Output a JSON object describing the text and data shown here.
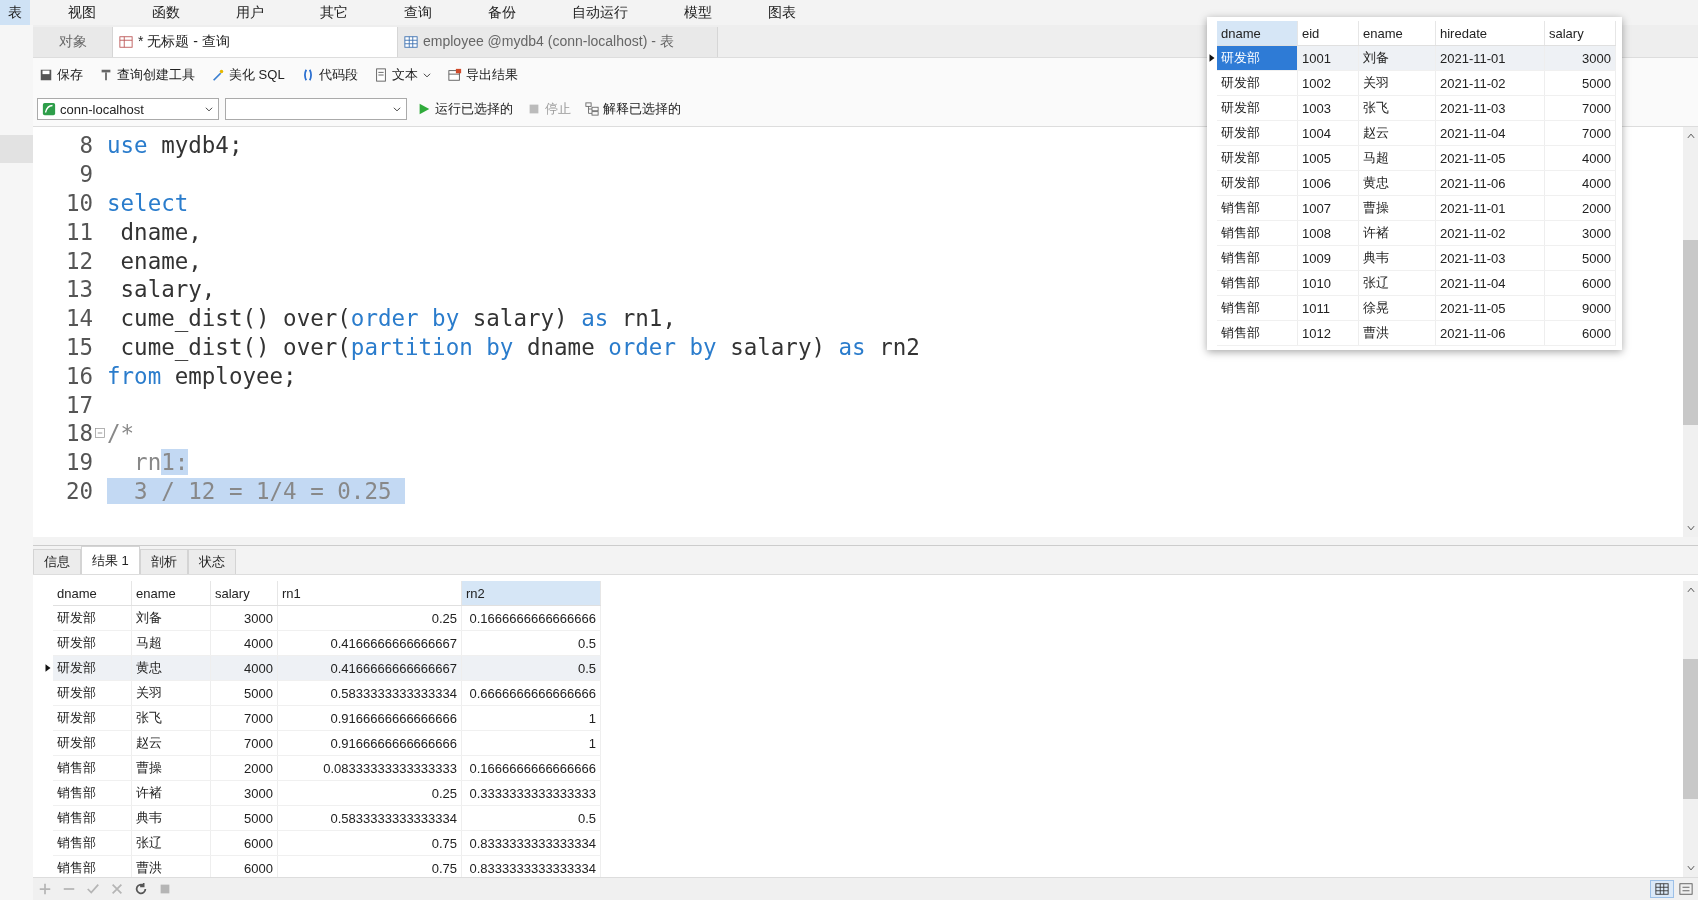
{
  "menu": [
    {
      "label": "表",
      "selected": true
    },
    {
      "label": "视图",
      "selected": false
    },
    {
      "label": "函数",
      "selected": false
    },
    {
      "label": "用户",
      "selected": false
    },
    {
      "label": "其它",
      "selected": false
    },
    {
      "label": "查询",
      "selected": false
    },
    {
      "label": "备份",
      "selected": false
    },
    {
      "label": "自动运行",
      "selected": false
    },
    {
      "label": "模型",
      "selected": false
    },
    {
      "label": "图表",
      "selected": false
    }
  ],
  "tabs": [
    {
      "label": "对象",
      "kind": "plain",
      "selected": false
    },
    {
      "label": "* 无标题 - 查询",
      "kind": "query",
      "selected": true
    },
    {
      "label": "employee @mydb4 (conn-localhost) - 表",
      "kind": "table",
      "selected": false
    }
  ],
  "toolbar": [
    {
      "label": "保存",
      "kind": "save"
    },
    {
      "label": "查询创建工具",
      "kind": "builder"
    },
    {
      "label": "美化 SQL",
      "kind": "beautify"
    },
    {
      "label": "代码段",
      "kind": "snippet"
    },
    {
      "label": "文本",
      "kind": "text"
    },
    {
      "label": "导出结果",
      "kind": "export"
    }
  ],
  "connection": {
    "value": "conn-localhost"
  },
  "run_bar": [
    {
      "label": "运行已选择的",
      "kind": "run",
      "disabled": false
    },
    {
      "label": "停止",
      "kind": "stop",
      "disabled": true
    },
    {
      "label": "解释已选择的",
      "kind": "explain",
      "disabled": false
    }
  ],
  "editor": {
    "lines": [
      {
        "number": "8",
        "fold": false,
        "segments": [
          {
            "text": "use",
            "kind": "keyword",
            "selected": false
          },
          {
            "text": " mydb4;",
            "kind": "plain",
            "selected": false
          }
        ]
      },
      {
        "number": "9",
        "fold": false
      },
      {
        "number": "10",
        "fold": false,
        "segments": [
          {
            "text": "select",
            "kind": "keyword",
            "selected": false
          }
        ]
      },
      {
        "number": "11",
        "fold": false,
        "segments": [
          {
            "text": " dname,",
            "kind": "plain",
            "selected": false
          }
        ]
      },
      {
        "number": "12",
        "fold": false,
        "segments": [
          {
            "text": " ename,",
            "kind": "plain",
            "selected": false
          }
        ]
      },
      {
        "number": "13",
        "fold": false,
        "segments": [
          {
            "text": " salary,",
            "kind": "plain",
            "selected": false
          }
        ]
      },
      {
        "number": "14",
        "fold": false,
        "segments": [
          {
            "text": " cume_dist() over(",
            "kind": "plain",
            "selected": false
          },
          {
            "text": "order by",
            "kind": "keyword",
            "selected": false
          },
          {
            "text": " salary) ",
            "kind": "plain",
            "selected": false
          },
          {
            "text": "as",
            "kind": "keyword",
            "selected": false
          },
          {
            "text": " rn1,",
            "kind": "plain",
            "selected": false
          }
        ]
      },
      {
        "number": "15",
        "fold": false,
        "segments": [
          {
            "text": " cume_dist() over(",
            "kind": "plain",
            "selected": false
          },
          {
            "text": "partition by",
            "kind": "keyword",
            "selected": false
          },
          {
            "text": " dname ",
            "kind": "plain",
            "selected": false
          },
          {
            "text": "order by",
            "kind": "keyword",
            "selected": false
          },
          {
            "text": " salary) ",
            "kind": "plain",
            "selected": false
          },
          {
            "text": "as",
            "kind": "keyword",
            "selected": false
          },
          {
            "text": " rn2",
            "kind": "plain",
            "selected": false
          }
        ]
      },
      {
        "number": "16",
        "fold": false,
        "segments": [
          {
            "text": "from",
            "kind": "keyword",
            "selected": false
          },
          {
            "text": " employee;",
            "kind": "plain",
            "selected": false
          }
        ]
      },
      {
        "number": "17",
        "fold": false
      },
      {
        "number": "18",
        "fold": true,
        "segments": [
          {
            "text": "/*",
            "kind": "comment",
            "selected": false
          }
        ]
      },
      {
        "number": "19",
        "fold": false,
        "segments": [
          {
            "text": "  rn",
            "kind": "comment",
            "selected": false
          },
          {
            "text": "1:",
            "kind": "comment",
            "selected": true
          }
        ]
      },
      {
        "number": "20",
        "fold": false,
        "segments": [
          {
            "text": "  3 / 12 = 1/4 = 0.25 ",
            "kind": "comment",
            "selected": true
          }
        ]
      }
    ]
  },
  "result_tabs": [
    {
      "label": "信息",
      "selected": false
    },
    {
      "label": "结果 1",
      "selected": true
    },
    {
      "label": "剖析",
      "selected": false
    },
    {
      "label": "状态",
      "selected": false
    }
  ],
  "result": {
    "columns": [
      {
        "label": "dname",
        "kind": "text",
        "selected": false
      },
      {
        "label": "ename",
        "kind": "text",
        "selected": false
      },
      {
        "label": "salary",
        "kind": "number",
        "selected": false
      },
      {
        "label": "rn1",
        "kind": "number",
        "selected": false
      },
      {
        "label": "rn2",
        "kind": "number",
        "selected": true
      }
    ],
    "rows": [
      {
        "selected": false,
        "cells": [
          "研发部",
          "刘备",
          "3000",
          "0.25",
          "0.1666666666666666"
        ]
      },
      {
        "selected": false,
        "cells": [
          "研发部",
          "马超",
          "4000",
          "0.4166666666666667",
          "0.5"
        ]
      },
      {
        "selected": true,
        "cells": [
          "研发部",
          "黄忠",
          "4000",
          "0.4166666666666667",
          "0.5"
        ]
      },
      {
        "selected": false,
        "cells": [
          "研发部",
          "关羽",
          "5000",
          "0.5833333333333334",
          "0.6666666666666666"
        ]
      },
      {
        "selected": false,
        "cells": [
          "研发部",
          "张飞",
          "7000",
          "0.9166666666666666",
          "1"
        ]
      },
      {
        "selected": false,
        "cells": [
          "研发部",
          "赵云",
          "7000",
          "0.9166666666666666",
          "1"
        ]
      },
      {
        "selected": false,
        "cells": [
          "销售部",
          "曹操",
          "2000",
          "0.08333333333333333",
          "0.1666666666666666"
        ]
      },
      {
        "selected": false,
        "cells": [
          "销售部",
          "许褚",
          "3000",
          "0.25",
          "0.3333333333333333"
        ]
      },
      {
        "selected": false,
        "cells": [
          "销售部",
          "典韦",
          "5000",
          "0.5833333333333334",
          "0.5"
        ]
      },
      {
        "selected": false,
        "cells": [
          "销售部",
          "张辽",
          "6000",
          "0.75",
          "0.8333333333333334"
        ]
      },
      {
        "selected": false,
        "cells": [
          "销售部",
          "曹洪",
          "6000",
          "0.75",
          "0.8333333333333334"
        ]
      }
    ]
  },
  "popup_table": {
    "columns": [
      {
        "label": "dname",
        "kind": "text",
        "selected": true
      },
      {
        "label": "eid",
        "kind": "text",
        "selected": false
      },
      {
        "label": "ename",
        "kind": "text",
        "selected": false
      },
      {
        "label": "hiredate",
        "kind": "text",
        "selected": false
      },
      {
        "label": "salary",
        "kind": "number",
        "selected": false
      }
    ],
    "rows": [
      {
        "selected": true,
        "cells": [
          "研发部",
          "1001",
          "刘备",
          "2021-11-01",
          "3000"
        ]
      },
      {
        "selected": false,
        "cells": [
          "研发部",
          "1002",
          "关羽",
          "2021-11-02",
          "5000"
        ]
      },
      {
        "selected": false,
        "cells": [
          "研发部",
          "1003",
          "张飞",
          "2021-11-03",
          "7000"
        ]
      },
      {
        "selected": false,
        "cells": [
          "研发部",
          "1004",
          "赵云",
          "2021-11-04",
          "7000"
        ]
      },
      {
        "selected": false,
        "cells": [
          "研发部",
          "1005",
          "马超",
          "2021-11-05",
          "4000"
        ]
      },
      {
        "selected": false,
        "cells": [
          "研发部",
          "1006",
          "黄忠",
          "2021-11-06",
          "4000"
        ]
      },
      {
        "selected": false,
        "cells": [
          "销售部",
          "1007",
          "曹操",
          "2021-11-01",
          "2000"
        ]
      },
      {
        "selected": false,
        "cells": [
          "销售部",
          "1008",
          "许褚",
          "2021-11-02",
          "3000"
        ]
      },
      {
        "selected": false,
        "cells": [
          "销售部",
          "1009",
          "典韦",
          "2021-11-03",
          "5000"
        ]
      },
      {
        "selected": false,
        "cells": [
          "销售部",
          "1010",
          "张辽",
          "2021-11-04",
          "6000"
        ]
      },
      {
        "selected": false,
        "cells": [
          "销售部",
          "1011",
          "徐晃",
          "2021-11-05",
          "9000"
        ]
      },
      {
        "selected": false,
        "cells": [
          "销售部",
          "1012",
          "曹洪",
          "2021-11-06",
          "6000"
        ]
      }
    ]
  },
  "grid_actions": [
    {
      "kind": "add",
      "disabled": true
    },
    {
      "kind": "remove",
      "disabled": true
    },
    {
      "kind": "apply",
      "disabled": true
    },
    {
      "kind": "cancel",
      "disabled": true
    },
    {
      "kind": "refresh",
      "disabled": false
    },
    {
      "kind": "stop",
      "disabled": true
    }
  ],
  "view_modes": [
    {
      "kind": "grid",
      "selected": true
    },
    {
      "kind": "form",
      "selected": false
    }
  ]
}
